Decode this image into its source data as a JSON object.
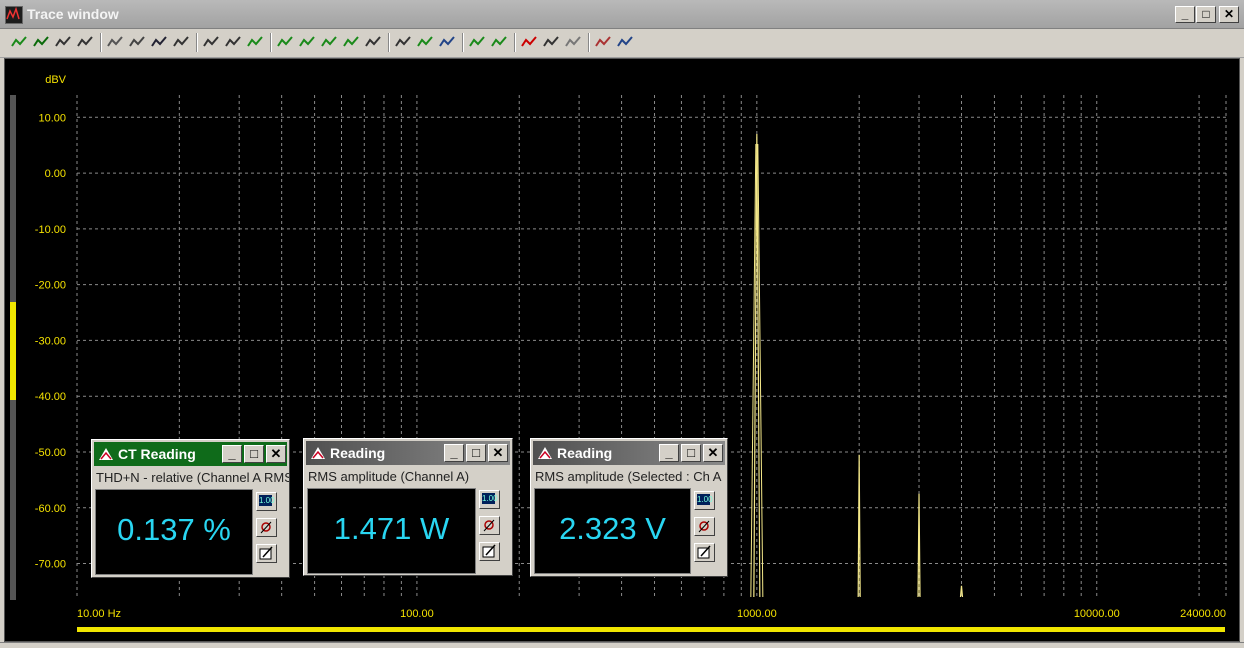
{
  "window": {
    "title": "Trace window",
    "minimize": "_",
    "maximize": "□",
    "close": "✕"
  },
  "toolbar": {
    "icons": [
      "add-trace-icon",
      "remove-trace-icon",
      "save-icon",
      "copy-icon",
      "grid-icon",
      "print-icon",
      "properties-icon",
      "table-icon",
      "zoom-fit-icon",
      "zoom-box-icon",
      "autoscale-icon",
      "peak-next-icon",
      "peak-prev-icon",
      "peak-both-icon",
      "peak-down-icon",
      "zoom-in-icon",
      "zoom-out-icon",
      "overlay-icon",
      "cursor-icon",
      "marker-up-icon",
      "marker-down-icon",
      "thd-icon",
      "compare-icon",
      "smooth-icon",
      "average-icon",
      "swap-icon"
    ]
  },
  "chart_data": {
    "type": "line",
    "title": "",
    "xlabel": "",
    "ylabel": "dBV",
    "xscale": "log",
    "xlim": [
      10,
      24000
    ],
    "ylim": [
      -76,
      14
    ],
    "y_ticks": [
      "10.00",
      "0.00",
      "-10.00",
      "-20.00",
      "-30.00",
      "-40.00",
      "-50.00",
      "-60.00",
      "-70.00"
    ],
    "x_ticks": [
      "10.00 Hz",
      "100.00",
      "1000.00",
      "10000.00",
      "24000.00"
    ],
    "grid": true,
    "series": [
      {
        "peaks": [
          {
            "x": 1000,
            "y": 7
          },
          {
            "x": 2000,
            "y": -50.5
          },
          {
            "x": 3000,
            "y": -57.5
          },
          {
            "x": 4000,
            "y": -74
          }
        ],
        "color": "#f5e98a"
      }
    ]
  },
  "panels": [
    {
      "title": "CT Reading",
      "subtitle": "THD+N - relative (Channel A RMS",
      "value": "0.137 %"
    },
    {
      "title": "Reading",
      "subtitle": "RMS amplitude (Channel A)",
      "value": "1.471 W"
    },
    {
      "title": "Reading",
      "subtitle": "RMS amplitude (Selected : Ch A",
      "value": "2.323 V"
    }
  ],
  "panel_side": {
    "scale_label": "1.00"
  },
  "colors": {
    "trace": "#f5e98a",
    "labels": "#f5e200",
    "value": "#29d6f2",
    "active_title": "#0f6b1a"
  }
}
